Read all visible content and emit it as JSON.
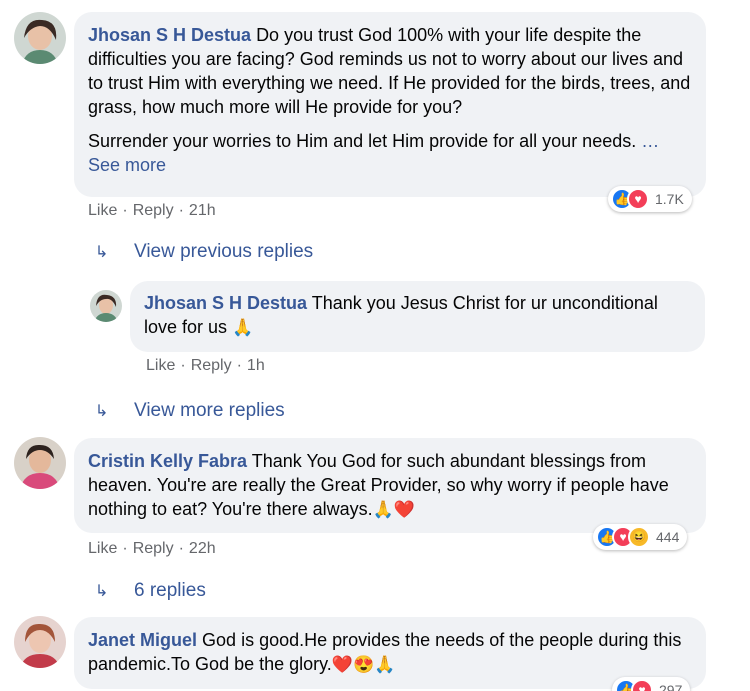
{
  "comments": [
    {
      "author": "Jhosan S H Destua",
      "text": "Do you trust God 100% with your life despite the difficulties you are facing? God reminds us not to worry about our lives and to trust Him with everything we need. If He provided for the birds, trees, and grass, how much more will He provide for you?",
      "text2": "Surrender your worries to Him and let Him provide for all your needs.",
      "see_more": "… See more",
      "like": "Like",
      "reply": "Reply",
      "time": "21h",
      "reaction_count": "1.7K",
      "reaction_icons": [
        "like-icon",
        "love-icon"
      ]
    },
    {
      "author": "Cristin Kelly Fabra",
      "text": "Thank You God for such abundant blessings from heaven. You're are really the Great Provider, so why worry if people have nothing to eat? You're there always.",
      "emojis": "🙏❤️",
      "like": "Like",
      "reply": "Reply",
      "time": "22h",
      "reaction_count": "444",
      "reaction_icons": [
        "like-icon",
        "love-icon",
        "haha-icon"
      ]
    },
    {
      "author": "Janet Miguel",
      "text": "God is good.He provides the needs of the people during this pandemic.To God be the glory.",
      "emojis": "❤️😍🙏",
      "reaction_count": "297",
      "reaction_icons": [
        "like-icon",
        "love-icon"
      ]
    }
  ],
  "replies": [
    {
      "author": "Jhosan S H Destua",
      "text": "Thank you Jesus Christ for ur unconditional love for us",
      "emojis": "🙏",
      "like": "Like",
      "reply": "Reply",
      "time": "1h"
    }
  ],
  "reply_links": {
    "view_previous": "View previous replies",
    "view_more": "View more replies",
    "six_replies": "6 replies"
  },
  "colors": {
    "name": "#385898",
    "bubble": "#f0f2f5",
    "meta": "#65676b",
    "like": "#1877f2",
    "love": "#f33e58",
    "haha": "#f7b928"
  }
}
